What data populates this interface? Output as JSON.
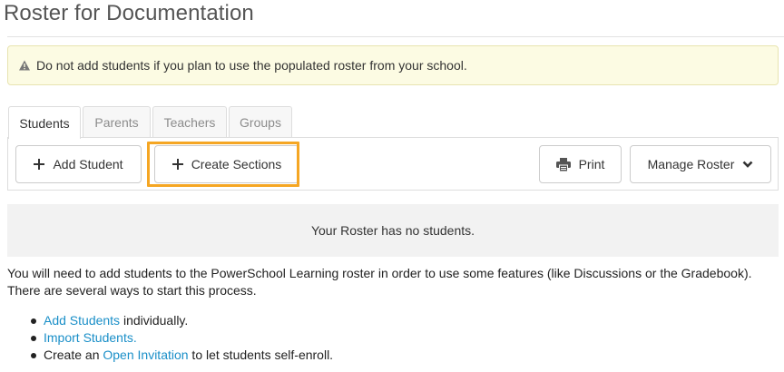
{
  "page": {
    "title": "Roster for Documentation"
  },
  "alert": {
    "icon": "warning-icon",
    "text": "Do not add students if you plan to use the populated roster from your school."
  },
  "tabs": [
    {
      "label": "Students",
      "active": true
    },
    {
      "label": "Parents",
      "active": false
    },
    {
      "label": "Teachers",
      "active": false
    },
    {
      "label": "Groups",
      "active": false
    }
  ],
  "toolbar": {
    "add_student_label": "Add Student",
    "create_sections_label": "Create Sections",
    "print_label": "Print",
    "manage_roster_label": "Manage Roster"
  },
  "empty_state": {
    "text": "Your Roster has no students."
  },
  "info": {
    "paragraph": "You will need to add students to the PowerSchool Learning roster in order to use some features (like Discussions or the Gradebook). There are several ways to start this process."
  },
  "steps": [
    {
      "link": "Add Students",
      "suffix": " individually."
    },
    {
      "link": "Import Students.",
      "suffix": ""
    },
    {
      "prefix": "Create an ",
      "link": "Open Invitation",
      "suffix": " to let students self-enroll."
    }
  ],
  "colors": {
    "link": "#1a8fc8",
    "highlight": "#f5a623",
    "alert_bg": "#fcfbe3"
  }
}
